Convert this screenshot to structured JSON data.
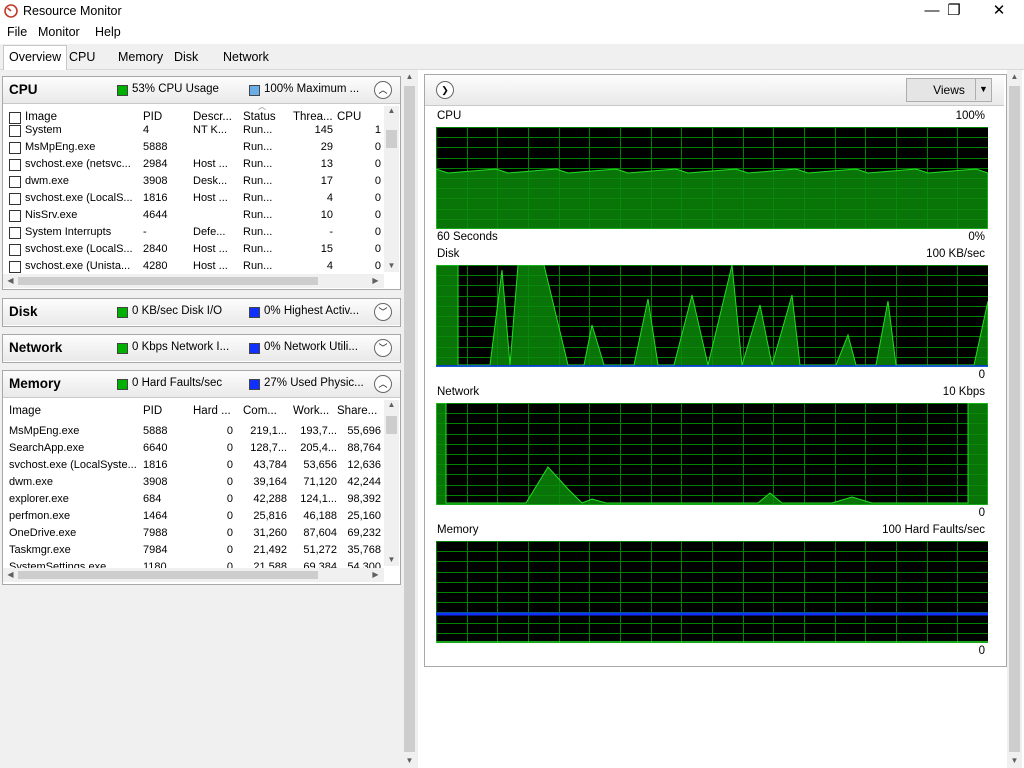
{
  "window": {
    "title": "Resource Monitor",
    "minimize": "—",
    "maximize": "❐",
    "close": "✕"
  },
  "menu": [
    "File",
    "Monitor",
    "Help"
  ],
  "tabs": [
    "Overview",
    "CPU",
    "Memory",
    "Disk",
    "Network"
  ],
  "colors": {
    "green": "#00b000",
    "blue": "#1030ff",
    "grid": "#008000",
    "fill": "#0a8a0a",
    "line": "#22dd22"
  },
  "cpu": {
    "title": "CPU",
    "stat1": "53% CPU Usage",
    "stat2": "100% Maximum ...",
    "columns": [
      "Image",
      "PID",
      "Descr...",
      "Status",
      "Threa...",
      "CPU"
    ],
    "rows": [
      [
        "System",
        "4",
        "NT K...",
        "Run...",
        "145",
        "1"
      ],
      [
        "MsMpEng.exe",
        "5888",
        "",
        "Run...",
        "29",
        "0"
      ],
      [
        "svchost.exe (netsvc...",
        "2984",
        "Host ...",
        "Run...",
        "13",
        "0"
      ],
      [
        "dwm.exe",
        "3908",
        "Desk...",
        "Run...",
        "17",
        "0"
      ],
      [
        "svchost.exe (LocalS...",
        "1816",
        "Host ...",
        "Run...",
        "4",
        "0"
      ],
      [
        "NisSrv.exe",
        "4644",
        "",
        "Run...",
        "10",
        "0"
      ],
      [
        "System Interrupts",
        "-",
        "Defe...",
        "Run...",
        "-",
        "0"
      ],
      [
        "svchost.exe (LocalS...",
        "2840",
        "Host ...",
        "Run...",
        "15",
        "0"
      ],
      [
        "svchost.exe (Unista...",
        "4280",
        "Host ...",
        "Run...",
        "4",
        "0"
      ]
    ]
  },
  "disk": {
    "title": "Disk",
    "stat1": "0 KB/sec Disk I/O",
    "stat2": "0% Highest Activ..."
  },
  "network": {
    "title": "Network",
    "stat1": "0 Kbps Network I...",
    "stat2": "0% Network Utili..."
  },
  "memory": {
    "title": "Memory",
    "stat1": "0 Hard Faults/sec",
    "stat2": "27% Used Physic...",
    "columns": [
      "Image",
      "PID",
      "Hard ...",
      "Com...",
      "Work...",
      "Share..."
    ],
    "rows": [
      [
        "MsMpEng.exe",
        "5888",
        "0",
        "219,1...",
        "193,7...",
        "55,696"
      ],
      [
        "SearchApp.exe",
        "6640",
        "0",
        "128,7...",
        "205,4...",
        "88,764"
      ],
      [
        "svchost.exe (LocalSyste...",
        "1816",
        "0",
        "43,784",
        "53,656",
        "12,636"
      ],
      [
        "dwm.exe",
        "3908",
        "0",
        "39,164",
        "71,120",
        "42,244"
      ],
      [
        "explorer.exe",
        "684",
        "0",
        "42,288",
        "124,1...",
        "98,392"
      ],
      [
        "perfmon.exe",
        "1464",
        "0",
        "25,816",
        "46,188",
        "25,160"
      ],
      [
        "OneDrive.exe",
        "7988",
        "0",
        "31,260",
        "87,604",
        "69,232"
      ],
      [
        "Taskmgr.exe",
        "7984",
        "0",
        "21,492",
        "51,272",
        "35,768"
      ],
      [
        "SystemSettings.exe",
        "1180",
        "0",
        "21,588",
        "69,384",
        "54,300"
      ]
    ]
  },
  "views_label": "Views",
  "graphs": {
    "cpu": {
      "title": "CPU",
      "max": "100%",
      "time": "60 Seconds",
      "min": "0%"
    },
    "disk": {
      "title": "Disk",
      "max": "100 KB/sec",
      "min": "0"
    },
    "network": {
      "title": "Network",
      "max": "10 Kbps",
      "min": "0"
    },
    "memory": {
      "title": "Memory",
      "max": "100 Hard Faults/sec",
      "min": "0"
    }
  }
}
